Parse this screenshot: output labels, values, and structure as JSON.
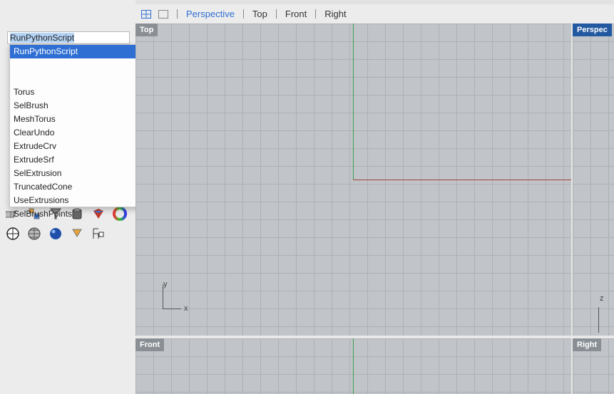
{
  "command": {
    "value": "RunPythonScript"
  },
  "dropdown": {
    "highlighted": "RunPythonScript",
    "items": [
      "Torus",
      "SelBrush",
      "MeshTorus",
      "ClearUndo",
      "ExtrudeCrv",
      "ExtrudeSrf",
      "SelExtrusion",
      "TruncatedCone",
      "UseExtrusions",
      "SelBrushPoints"
    ]
  },
  "tabs": {
    "perspective": "Perspective",
    "top": "Top",
    "front": "Front",
    "right": "Right",
    "active": "Perspective"
  },
  "viewports": {
    "top": "Top",
    "perspective": "Perspec",
    "front": "Front",
    "right": "Right"
  },
  "axes": {
    "top_y": "y",
    "top_x": "x",
    "persp_z": "z"
  },
  "colors": {
    "accent": "#2f6fd4",
    "x_axis": "#a0443a",
    "y_axis": "#3aa04a"
  }
}
